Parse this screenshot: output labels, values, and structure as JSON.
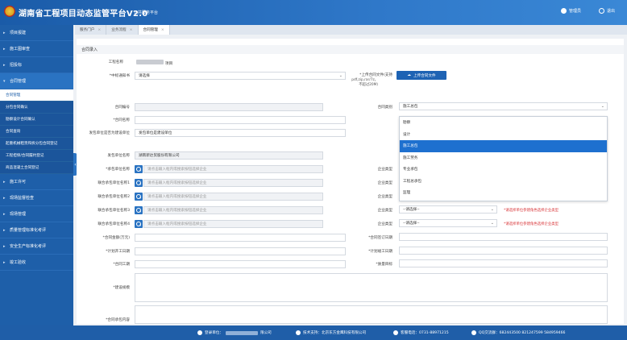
{
  "header": {
    "title": "湖南省工程项目动态监管平台V2.0",
    "subtitle": "公共服务平台",
    "user_label": "管理员",
    "exit_label": "退出"
  },
  "sidebar": {
    "items": [
      {
        "label": "项目报建"
      },
      {
        "label": "施工图审查"
      },
      {
        "label": "招投标"
      },
      {
        "label": "合同管理"
      }
    ],
    "sub_items": [
      {
        "label": "合同管理"
      },
      {
        "label": "分包合同确认"
      },
      {
        "label": "勘察设计合同确认"
      },
      {
        "label": "合同查询"
      },
      {
        "label": "起重机械租赁和拆分包合同登记"
      },
      {
        "label": "工程担保/合同履约登记"
      },
      {
        "label": "商品混凝土合同登记"
      }
    ],
    "items_after": [
      {
        "label": "施工许可"
      },
      {
        "label": "现场监督检查"
      },
      {
        "label": "现场管理"
      },
      {
        "label": "质量管理标准化考评"
      },
      {
        "label": "安全生产标准化考评"
      },
      {
        "label": "竣工验收"
      }
    ]
  },
  "tabs": [
    {
      "label": "服务门户"
    },
    {
      "label": "业务流程"
    },
    {
      "label": "合同管理"
    }
  ],
  "form": {
    "section_title": "合同录入",
    "project_name_label": "工程名称",
    "project_name_suffix": "项目",
    "bid_section_label": "*中标通知书",
    "bid_section_value": "请选择",
    "upload_label": "*上传合同文件(支持",
    "upload_note": "pdf,zip,rar/7z，不超过20M)",
    "upload_button": "上传合同文件",
    "contract_no_label": "合同编号",
    "contract_type_label": "合同类别",
    "contract_type_value": "施工总包",
    "contract_name_label": "*合同名称",
    "issuer_type_label": "发包单位是否为建设单位",
    "issuer_type_value": "发包单位是建设单位",
    "issuer_name_label": "发包单位名称",
    "issuer_name_value": "湖南新达贸股份有限公司",
    "contractor_label": "*承包单位名称",
    "joint1_label": "联合承包单位名称1",
    "joint2_label": "联合承包单位名称2",
    "joint3_label": "联合承包单位名称3",
    "joint4_label": "联合承包单位名称4",
    "search_placeholder": "请点击输入框内或搜索按钮选择企业",
    "company_type_label": "企业类型",
    "company_type_placeholder": "--请选择--",
    "warn_text": "*请选择单位参建角色选择企业类型",
    "amount_label": "*合同金额(万元)",
    "sign_date_label": "*合同签订日期",
    "start_date_label": "*计划开工日期",
    "end_date_label": "*计划竣工日期",
    "duration_label": "*合同工期",
    "quality_label": "*质量目标",
    "scale_label": "*建设规模",
    "content_label": "*合同承包内容"
  },
  "dropdown": {
    "options": [
      "勘察",
      "设计",
      "施工总包",
      "施工劳务",
      "专业承包",
      "工程总承包",
      "监理"
    ],
    "selected": "施工总包"
  },
  "footer": {
    "register_label": "登录单位：",
    "register_suffix": "限公司",
    "support_label": "技术支持：北京东方金鹰科技有限公司",
    "hotline": "客服电话：0731-88971215",
    "qq": "QQ交流群：682443500 821247599 584959466"
  },
  "colors": {
    "primary": "#1e5fa9",
    "accent": "#1e70cf",
    "warn": "#d9373a"
  }
}
